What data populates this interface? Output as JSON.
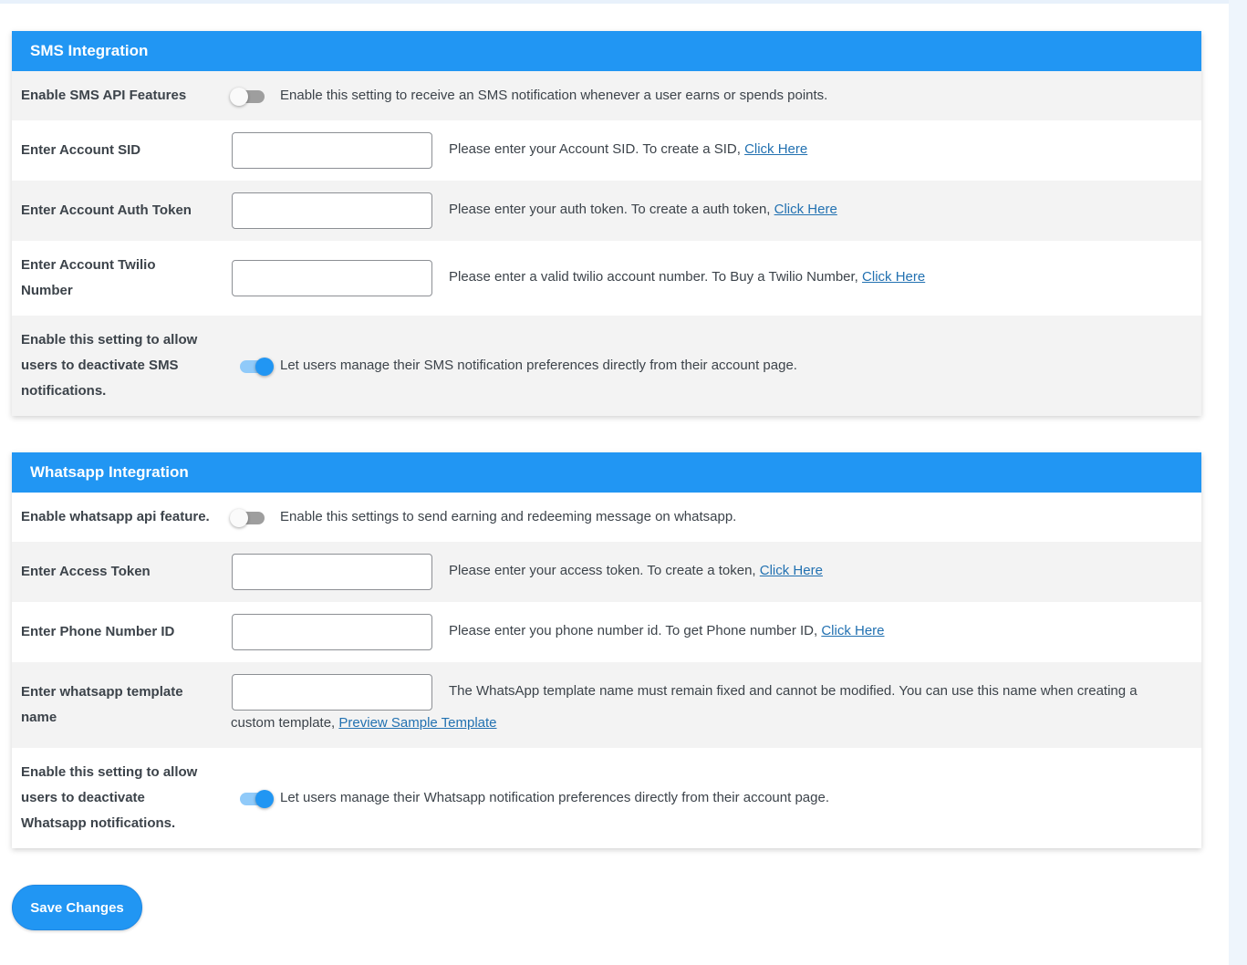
{
  "sms": {
    "title": "SMS Integration",
    "enable_label": "Enable SMS API Features",
    "enable_desc": "Enable this setting to receive an SMS notification whenever a user earns or spends points.",
    "enable_on": false,
    "sid_label": "Enter Account SID",
    "sid_value": "",
    "sid_desc": "Please enter your Account SID. To create a SID, ",
    "sid_link": "Click Here",
    "token_label": "Enter Account Auth Token",
    "token_value": "",
    "token_desc": "Please enter your auth token. To create a auth token, ",
    "token_link": "Click Here",
    "number_label": "Enter Account Twilio Number",
    "number_value": "",
    "number_desc": "Please enter a valid twilio account number. To Buy a Twilio Number, ",
    "number_link": "Click Here",
    "deactivate_label": "Enable this setting to allow users to deactivate SMS notifications.",
    "deactivate_desc": "Let users manage their SMS notification preferences directly from their account page.",
    "deactivate_on": true
  },
  "whatsapp": {
    "title": "Whatsapp Integration",
    "enable_label": "Enable whatsapp api feature.",
    "enable_desc": "Enable this settings to send earning and redeeming message on whatsapp.",
    "enable_on": false,
    "access_label": "Enter Access Token",
    "access_value": "",
    "access_desc": "Please enter your access token. To create a token, ",
    "access_link": "Click Here",
    "phone_label": "Enter Phone Number ID",
    "phone_value": "",
    "phone_desc": "Please enter you phone number id. To get Phone number ID, ",
    "phone_link": "Click Here",
    "template_label": "Enter whatsapp template name",
    "template_value": "",
    "template_desc_line1": "The WhatsApp template name must remain fixed and cannot be modified. You can use this name when creating a",
    "template_desc_line2": "custom template, ",
    "template_link": "Preview Sample Template",
    "deactivate_label": "Enable this setting to allow users to deactivate Whatsapp notifications.",
    "deactivate_desc": "Let users manage their Whatsapp notification preferences directly from their account page.",
    "deactivate_on": true
  },
  "save_label": "Save Changes",
  "colors": {
    "accent": "#2196f3",
    "link": "#2271b1",
    "row_alt": "#f3f3f3"
  }
}
